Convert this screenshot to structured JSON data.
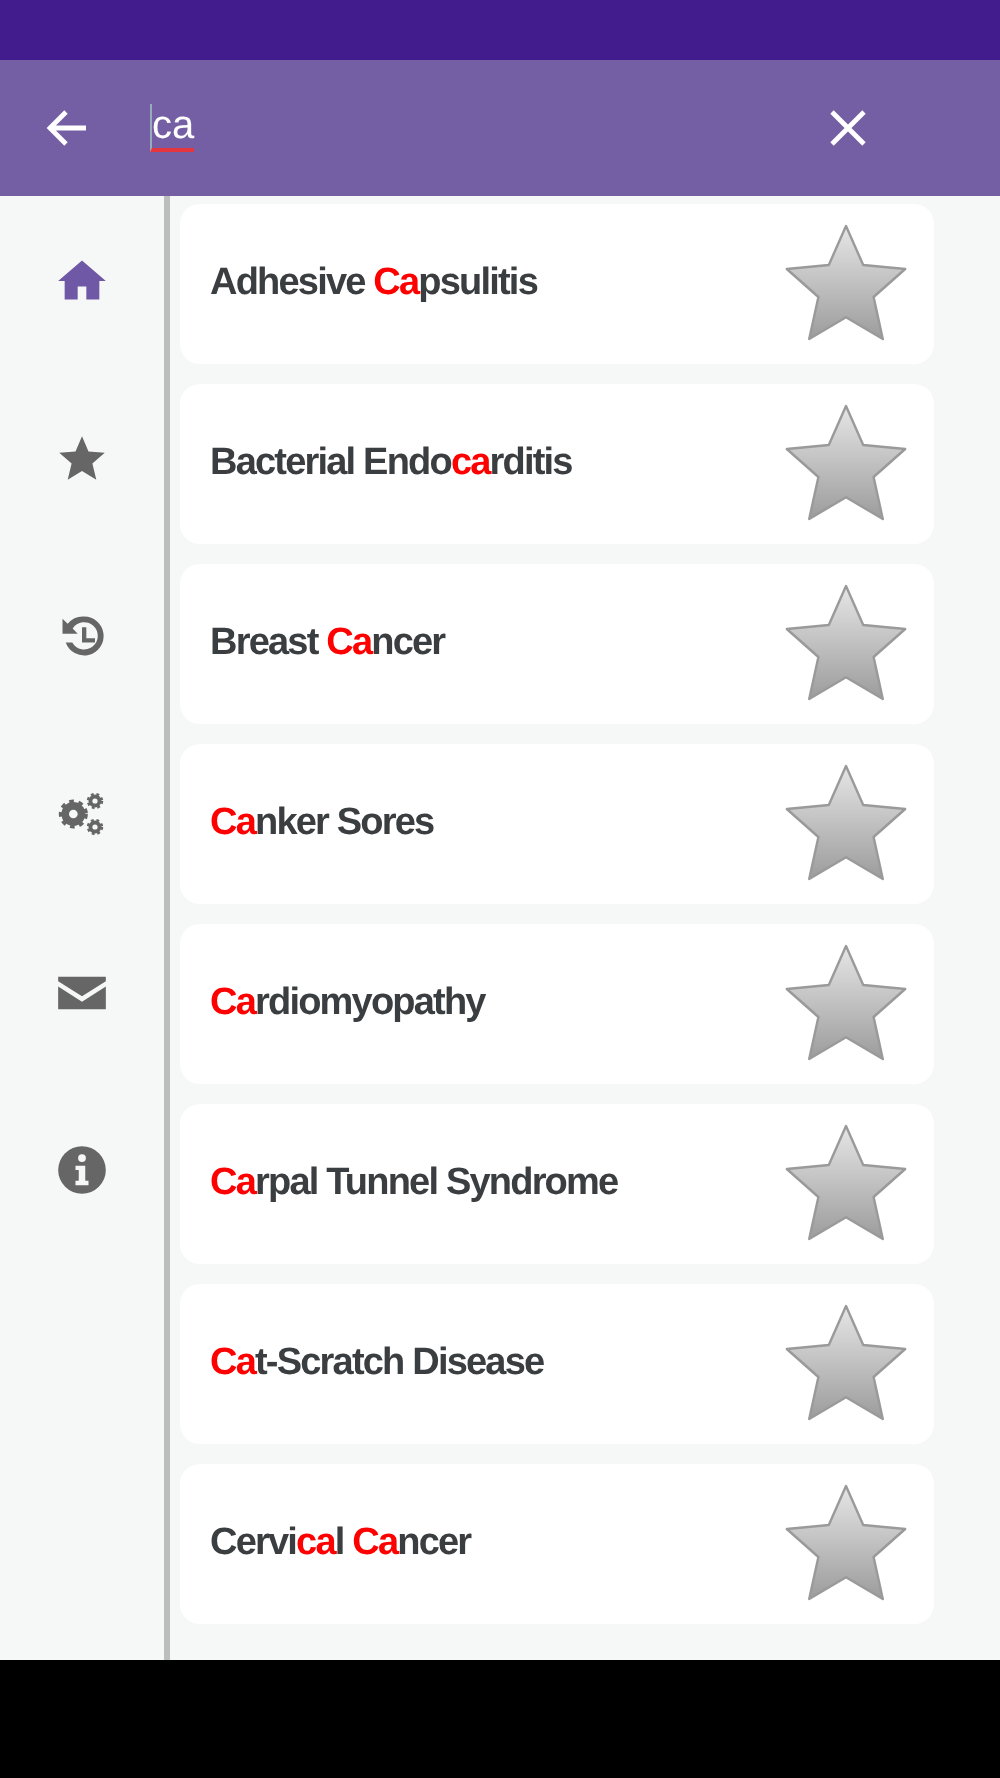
{
  "search": {
    "value": "ca"
  },
  "sidebar": {
    "items": [
      {
        "kind": "home",
        "selected": true
      },
      {
        "kind": "favorites",
        "selected": false
      },
      {
        "kind": "history",
        "selected": false
      },
      {
        "kind": "settings",
        "selected": false
      },
      {
        "kind": "mail",
        "selected": false
      },
      {
        "kind": "info",
        "selected": false
      }
    ]
  },
  "results": [
    {
      "favorite": false,
      "segments": [
        {
          "text": "Adhesive ",
          "match": false
        },
        {
          "text": "Ca",
          "match": true
        },
        {
          "text": "psulitis",
          "match": false
        }
      ]
    },
    {
      "favorite": false,
      "segments": [
        {
          "text": "Bacterial Endo",
          "match": false
        },
        {
          "text": "ca",
          "match": true
        },
        {
          "text": "rditis",
          "match": false
        }
      ]
    },
    {
      "favorite": false,
      "segments": [
        {
          "text": "Breast ",
          "match": false
        },
        {
          "text": "Ca",
          "match": true
        },
        {
          "text": "ncer",
          "match": false
        }
      ]
    },
    {
      "favorite": false,
      "segments": [
        {
          "text": "Ca",
          "match": true
        },
        {
          "text": "nker Sores",
          "match": false
        }
      ]
    },
    {
      "favorite": false,
      "segments": [
        {
          "text": "Ca",
          "match": true
        },
        {
          "text": "rdiomyopathy",
          "match": false
        }
      ]
    },
    {
      "favorite": false,
      "segments": [
        {
          "text": "Ca",
          "match": true
        },
        {
          "text": "rpal Tunnel Syndrome",
          "match": false
        }
      ]
    },
    {
      "favorite": false,
      "segments": [
        {
          "text": "Ca",
          "match": true
        },
        {
          "text": "t-Scratch Disease",
          "match": false
        }
      ]
    },
    {
      "favorite": false,
      "segments": [
        {
          "text": "Cervi",
          "match": false
        },
        {
          "text": "ca",
          "match": true
        },
        {
          "text": "l ",
          "match": false
        },
        {
          "text": "Ca",
          "match": true
        },
        {
          "text": "ncer",
          "match": false
        }
      ]
    }
  ]
}
